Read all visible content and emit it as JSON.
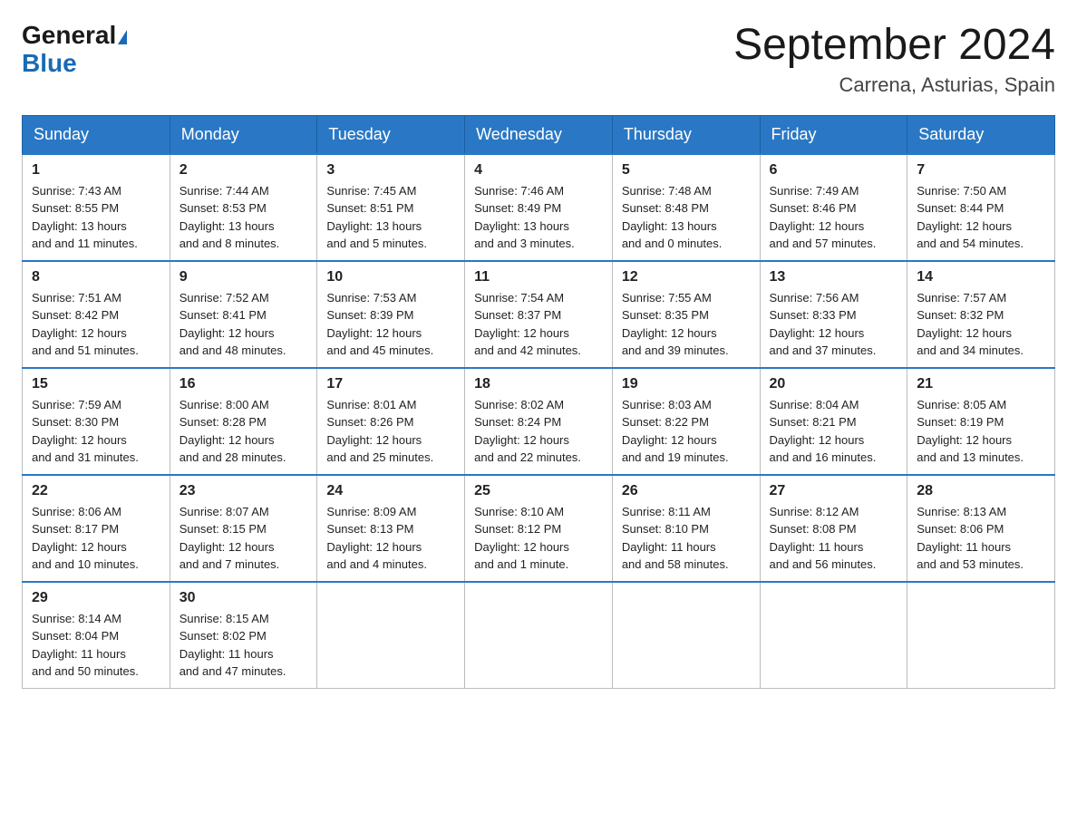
{
  "logo": {
    "general": "General",
    "blue": "Blue"
  },
  "title": "September 2024",
  "location": "Carrena, Asturias, Spain",
  "headers": [
    "Sunday",
    "Monday",
    "Tuesday",
    "Wednesday",
    "Thursday",
    "Friday",
    "Saturday"
  ],
  "weeks": [
    [
      {
        "day": "1",
        "sunrise": "7:43 AM",
        "sunset": "8:55 PM",
        "daylight": "13 hours and 11 minutes."
      },
      {
        "day": "2",
        "sunrise": "7:44 AM",
        "sunset": "8:53 PM",
        "daylight": "13 hours and 8 minutes."
      },
      {
        "day": "3",
        "sunrise": "7:45 AM",
        "sunset": "8:51 PM",
        "daylight": "13 hours and 5 minutes."
      },
      {
        "day": "4",
        "sunrise": "7:46 AM",
        "sunset": "8:49 PM",
        "daylight": "13 hours and 3 minutes."
      },
      {
        "day": "5",
        "sunrise": "7:48 AM",
        "sunset": "8:48 PM",
        "daylight": "13 hours and 0 minutes."
      },
      {
        "day": "6",
        "sunrise": "7:49 AM",
        "sunset": "8:46 PM",
        "daylight": "12 hours and 57 minutes."
      },
      {
        "day": "7",
        "sunrise": "7:50 AM",
        "sunset": "8:44 PM",
        "daylight": "12 hours and 54 minutes."
      }
    ],
    [
      {
        "day": "8",
        "sunrise": "7:51 AM",
        "sunset": "8:42 PM",
        "daylight": "12 hours and 51 minutes."
      },
      {
        "day": "9",
        "sunrise": "7:52 AM",
        "sunset": "8:41 PM",
        "daylight": "12 hours and 48 minutes."
      },
      {
        "day": "10",
        "sunrise": "7:53 AM",
        "sunset": "8:39 PM",
        "daylight": "12 hours and 45 minutes."
      },
      {
        "day": "11",
        "sunrise": "7:54 AM",
        "sunset": "8:37 PM",
        "daylight": "12 hours and 42 minutes."
      },
      {
        "day": "12",
        "sunrise": "7:55 AM",
        "sunset": "8:35 PM",
        "daylight": "12 hours and 39 minutes."
      },
      {
        "day": "13",
        "sunrise": "7:56 AM",
        "sunset": "8:33 PM",
        "daylight": "12 hours and 37 minutes."
      },
      {
        "day": "14",
        "sunrise": "7:57 AM",
        "sunset": "8:32 PM",
        "daylight": "12 hours and 34 minutes."
      }
    ],
    [
      {
        "day": "15",
        "sunrise": "7:59 AM",
        "sunset": "8:30 PM",
        "daylight": "12 hours and 31 minutes."
      },
      {
        "day": "16",
        "sunrise": "8:00 AM",
        "sunset": "8:28 PM",
        "daylight": "12 hours and 28 minutes."
      },
      {
        "day": "17",
        "sunrise": "8:01 AM",
        "sunset": "8:26 PM",
        "daylight": "12 hours and 25 minutes."
      },
      {
        "day": "18",
        "sunrise": "8:02 AM",
        "sunset": "8:24 PM",
        "daylight": "12 hours and 22 minutes."
      },
      {
        "day": "19",
        "sunrise": "8:03 AM",
        "sunset": "8:22 PM",
        "daylight": "12 hours and 19 minutes."
      },
      {
        "day": "20",
        "sunrise": "8:04 AM",
        "sunset": "8:21 PM",
        "daylight": "12 hours and 16 minutes."
      },
      {
        "day": "21",
        "sunrise": "8:05 AM",
        "sunset": "8:19 PM",
        "daylight": "12 hours and 13 minutes."
      }
    ],
    [
      {
        "day": "22",
        "sunrise": "8:06 AM",
        "sunset": "8:17 PM",
        "daylight": "12 hours and 10 minutes."
      },
      {
        "day": "23",
        "sunrise": "8:07 AM",
        "sunset": "8:15 PM",
        "daylight": "12 hours and 7 minutes."
      },
      {
        "day": "24",
        "sunrise": "8:09 AM",
        "sunset": "8:13 PM",
        "daylight": "12 hours and 4 minutes."
      },
      {
        "day": "25",
        "sunrise": "8:10 AM",
        "sunset": "8:12 PM",
        "daylight": "12 hours and 1 minute."
      },
      {
        "day": "26",
        "sunrise": "8:11 AM",
        "sunset": "8:10 PM",
        "daylight": "11 hours and 58 minutes."
      },
      {
        "day": "27",
        "sunrise": "8:12 AM",
        "sunset": "8:08 PM",
        "daylight": "11 hours and 56 minutes."
      },
      {
        "day": "28",
        "sunrise": "8:13 AM",
        "sunset": "8:06 PM",
        "daylight": "11 hours and 53 minutes."
      }
    ],
    [
      {
        "day": "29",
        "sunrise": "8:14 AM",
        "sunset": "8:04 PM",
        "daylight": "11 hours and 50 minutes."
      },
      {
        "day": "30",
        "sunrise": "8:15 AM",
        "sunset": "8:02 PM",
        "daylight": "11 hours and 47 minutes."
      },
      null,
      null,
      null,
      null,
      null
    ]
  ],
  "labels": {
    "sunrise": "Sunrise:",
    "sunset": "Sunset:",
    "daylight": "Daylight:"
  }
}
